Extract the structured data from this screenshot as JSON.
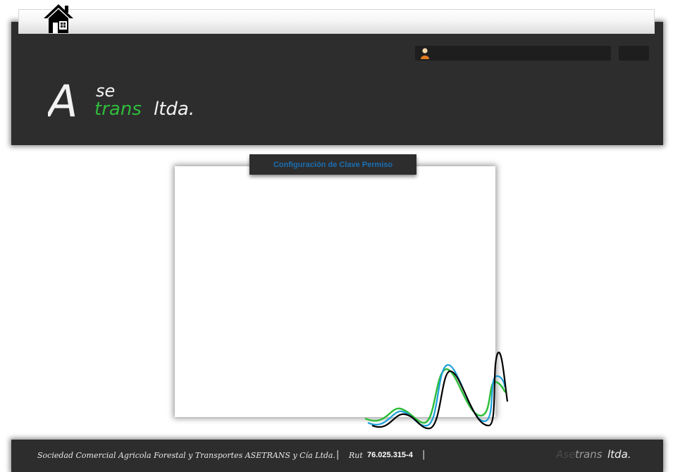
{
  "header": {
    "home_icon": "home-icon",
    "user_icon": "user-icon",
    "user_label": "",
    "button_label": "",
    "logo": {
      "part1": "A",
      "part2": "se",
      "part3": "trans",
      "part4": "ltda."
    },
    "colors": {
      "background": "#2d2d2d",
      "logo_green": "#2fbd3b",
      "logo_white": "#f2f2f2"
    }
  },
  "panel": {
    "tab_label": "Configuración de Clave Permiso",
    "tab_color": "#1a6fb3"
  },
  "footer": {
    "company": "Sociedad Comercial Agricola Forestal y Transportes ASETRANS y Cía Ltda.",
    "separator": "|",
    "rut_label": "Rut",
    "rut_value": "76.025.315-4",
    "logo": {
      "part1": "Ase",
      "part2": "trans",
      "part3": "ltda."
    }
  }
}
